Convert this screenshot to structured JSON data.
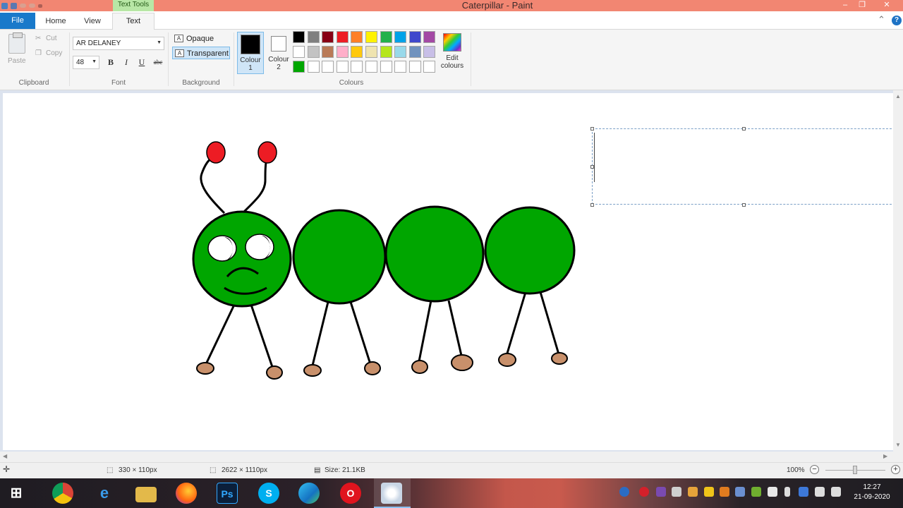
{
  "window": {
    "title": "Caterpillar - Paint",
    "context_tab": "Text Tools",
    "controls": [
      "–",
      "❐",
      "✕"
    ]
  },
  "tabs": {
    "file": "File",
    "home": "Home",
    "view": "View",
    "text": "Text"
  },
  "clipboard": {
    "paste": "Paste",
    "cut": "Cut",
    "copy": "Copy",
    "group": "Clipboard"
  },
  "font": {
    "family": "AR DELANEY",
    "size": "48",
    "bold": "B",
    "italic": "I",
    "underline": "U",
    "strike": "abc",
    "group": "Font"
  },
  "background": {
    "opaque": "Opaque",
    "transparent": "Transparent",
    "group": "Background"
  },
  "colours": {
    "colour1_line1": "Colour",
    "colour1_line2": "1",
    "colour2_line1": "Colour",
    "colour2_line2": "2",
    "colour1_value": "#000000",
    "colour2_value": "#ffffff",
    "edit_line1": "Edit",
    "edit_line2": "colours",
    "group": "Colours",
    "palette_row1": [
      "#000000",
      "#7f7f7f",
      "#880015",
      "#ed1c24",
      "#ff7f27",
      "#fff200",
      "#22b14c",
      "#00a2e8",
      "#3f48cc",
      "#a349a4"
    ],
    "palette_row2": [
      "#ffffff",
      "#c3c3c3",
      "#b97a57",
      "#ffaec9",
      "#ffc90e",
      "#efe4b0",
      "#b5e61d",
      "#99d9ea",
      "#7092be",
      "#c8bfe7"
    ],
    "palette_row3": [
      "#00a600",
      "#ffffff",
      "#ffffff",
      "#ffffff",
      "#ffffff",
      "#ffffff",
      "#ffffff",
      "#ffffff",
      "#ffffff",
      "#ffffff"
    ]
  },
  "canvas": {
    "body_color": "#00a600",
    "antenna_color": "#ed1c24",
    "foot_color": "#c8906b"
  },
  "status": {
    "selection": "330 × 110px",
    "canvas_size": "2622 × 1110px",
    "file_size": "Size: 21.1KB",
    "zoom": "100%"
  },
  "taskbar": {
    "apps": [
      "start-icon",
      "chrome-icon",
      "edge-legacy-icon",
      "file-explorer-icon",
      "firefox-icon",
      "photoshop-icon",
      "skype-icon",
      "edge-icon",
      "opera-icon",
      "paint-icon"
    ],
    "time": "12:27",
    "date": "21-09-2020"
  }
}
